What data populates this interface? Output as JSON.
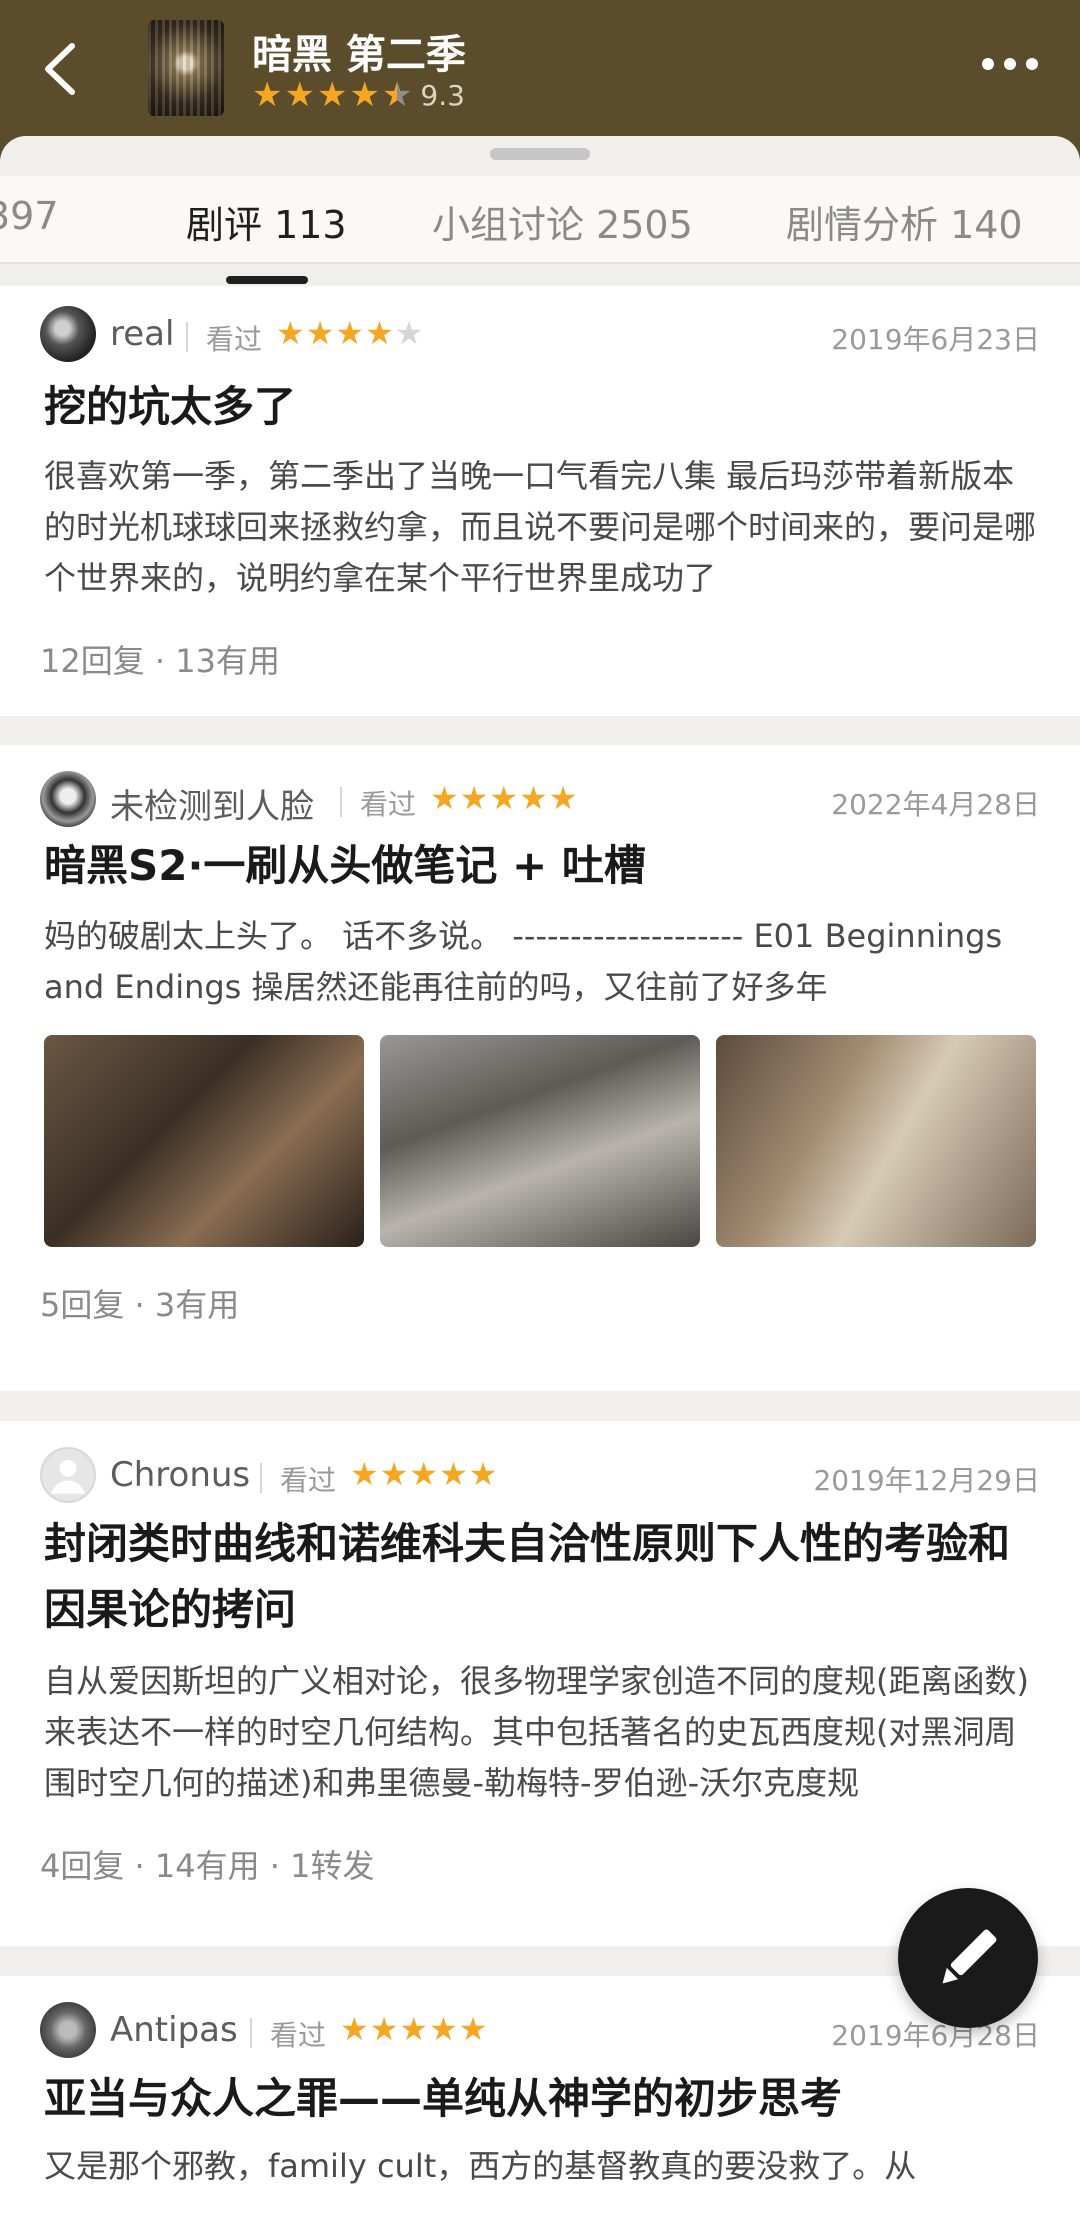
{
  "header": {
    "title": "暗黑 第二季",
    "rating": "9.3",
    "rating_stars": 4.5,
    "back_icon": "chevron-left-icon",
    "more_icon": "more-horizontal-icon"
  },
  "tabs": [
    {
      "label": "397"
    },
    {
      "label": "剧评 113",
      "active": true
    },
    {
      "label": "小组讨论 2505"
    },
    {
      "label": "剧情分析 140"
    }
  ],
  "reviews": [
    {
      "user": "real",
      "status": "看过",
      "stars": 4,
      "date": "2019年6月23日",
      "title": "挖的坑太多了",
      "excerpt": "很喜欢第一季，第二季出了当晚一口气看完八集 最后玛莎带着新版本的时光机球球回来拯救约拿，而且说不要问是哪个时间来的，要问是哪个世界来的，说明约拿在某个平行世界里成功了",
      "meta": "12回复 · 13有用"
    },
    {
      "user": "未检测到人脸",
      "status": "看过",
      "stars": 5,
      "date": "2022年4月28日",
      "title": "暗黑S2·一刷从头做笔记 + 吐槽",
      "excerpt": "妈的破剧太上头了。 话不多说。 -------------------- E01 Beginnings and Endings 操居然还能再往前的吗，又往前了好多年",
      "meta": "5回复 · 3有用"
    },
    {
      "user": "Chronus",
      "status": "看过",
      "stars": 5,
      "date": "2019年12月29日",
      "title": "封闭类时曲线和诺维科夫自洽性原则下人性的考验和因果论的拷问",
      "excerpt": "自从爱因斯坦的广义相对论，很多物理学家创造不同的度规(距离函数)来表达不一样的时空几何结构。其中包括著名的史瓦西度规(对黑洞周围时空几何的描述)和弗里德曼-勒梅特-罗伯逊-沃尔克度规",
      "meta": "4回复 · 14有用 · 1转发"
    },
    {
      "user": "Antipas",
      "status": "看过",
      "stars": 5,
      "date": "2019年6月28日",
      "title": "亚当与众人之罪——单纯从神学的初步思考",
      "excerpt": "又是那个邪教，family cult，西方的基督教真的要没救了。从"
    }
  ],
  "colors": {
    "header_bg": "#5b4d2c",
    "star_active": "#f5a623",
    "star_inactive": "#d6d6d6",
    "fab_bg": "#1a1a1a"
  },
  "fab_icon": "pencil-icon"
}
